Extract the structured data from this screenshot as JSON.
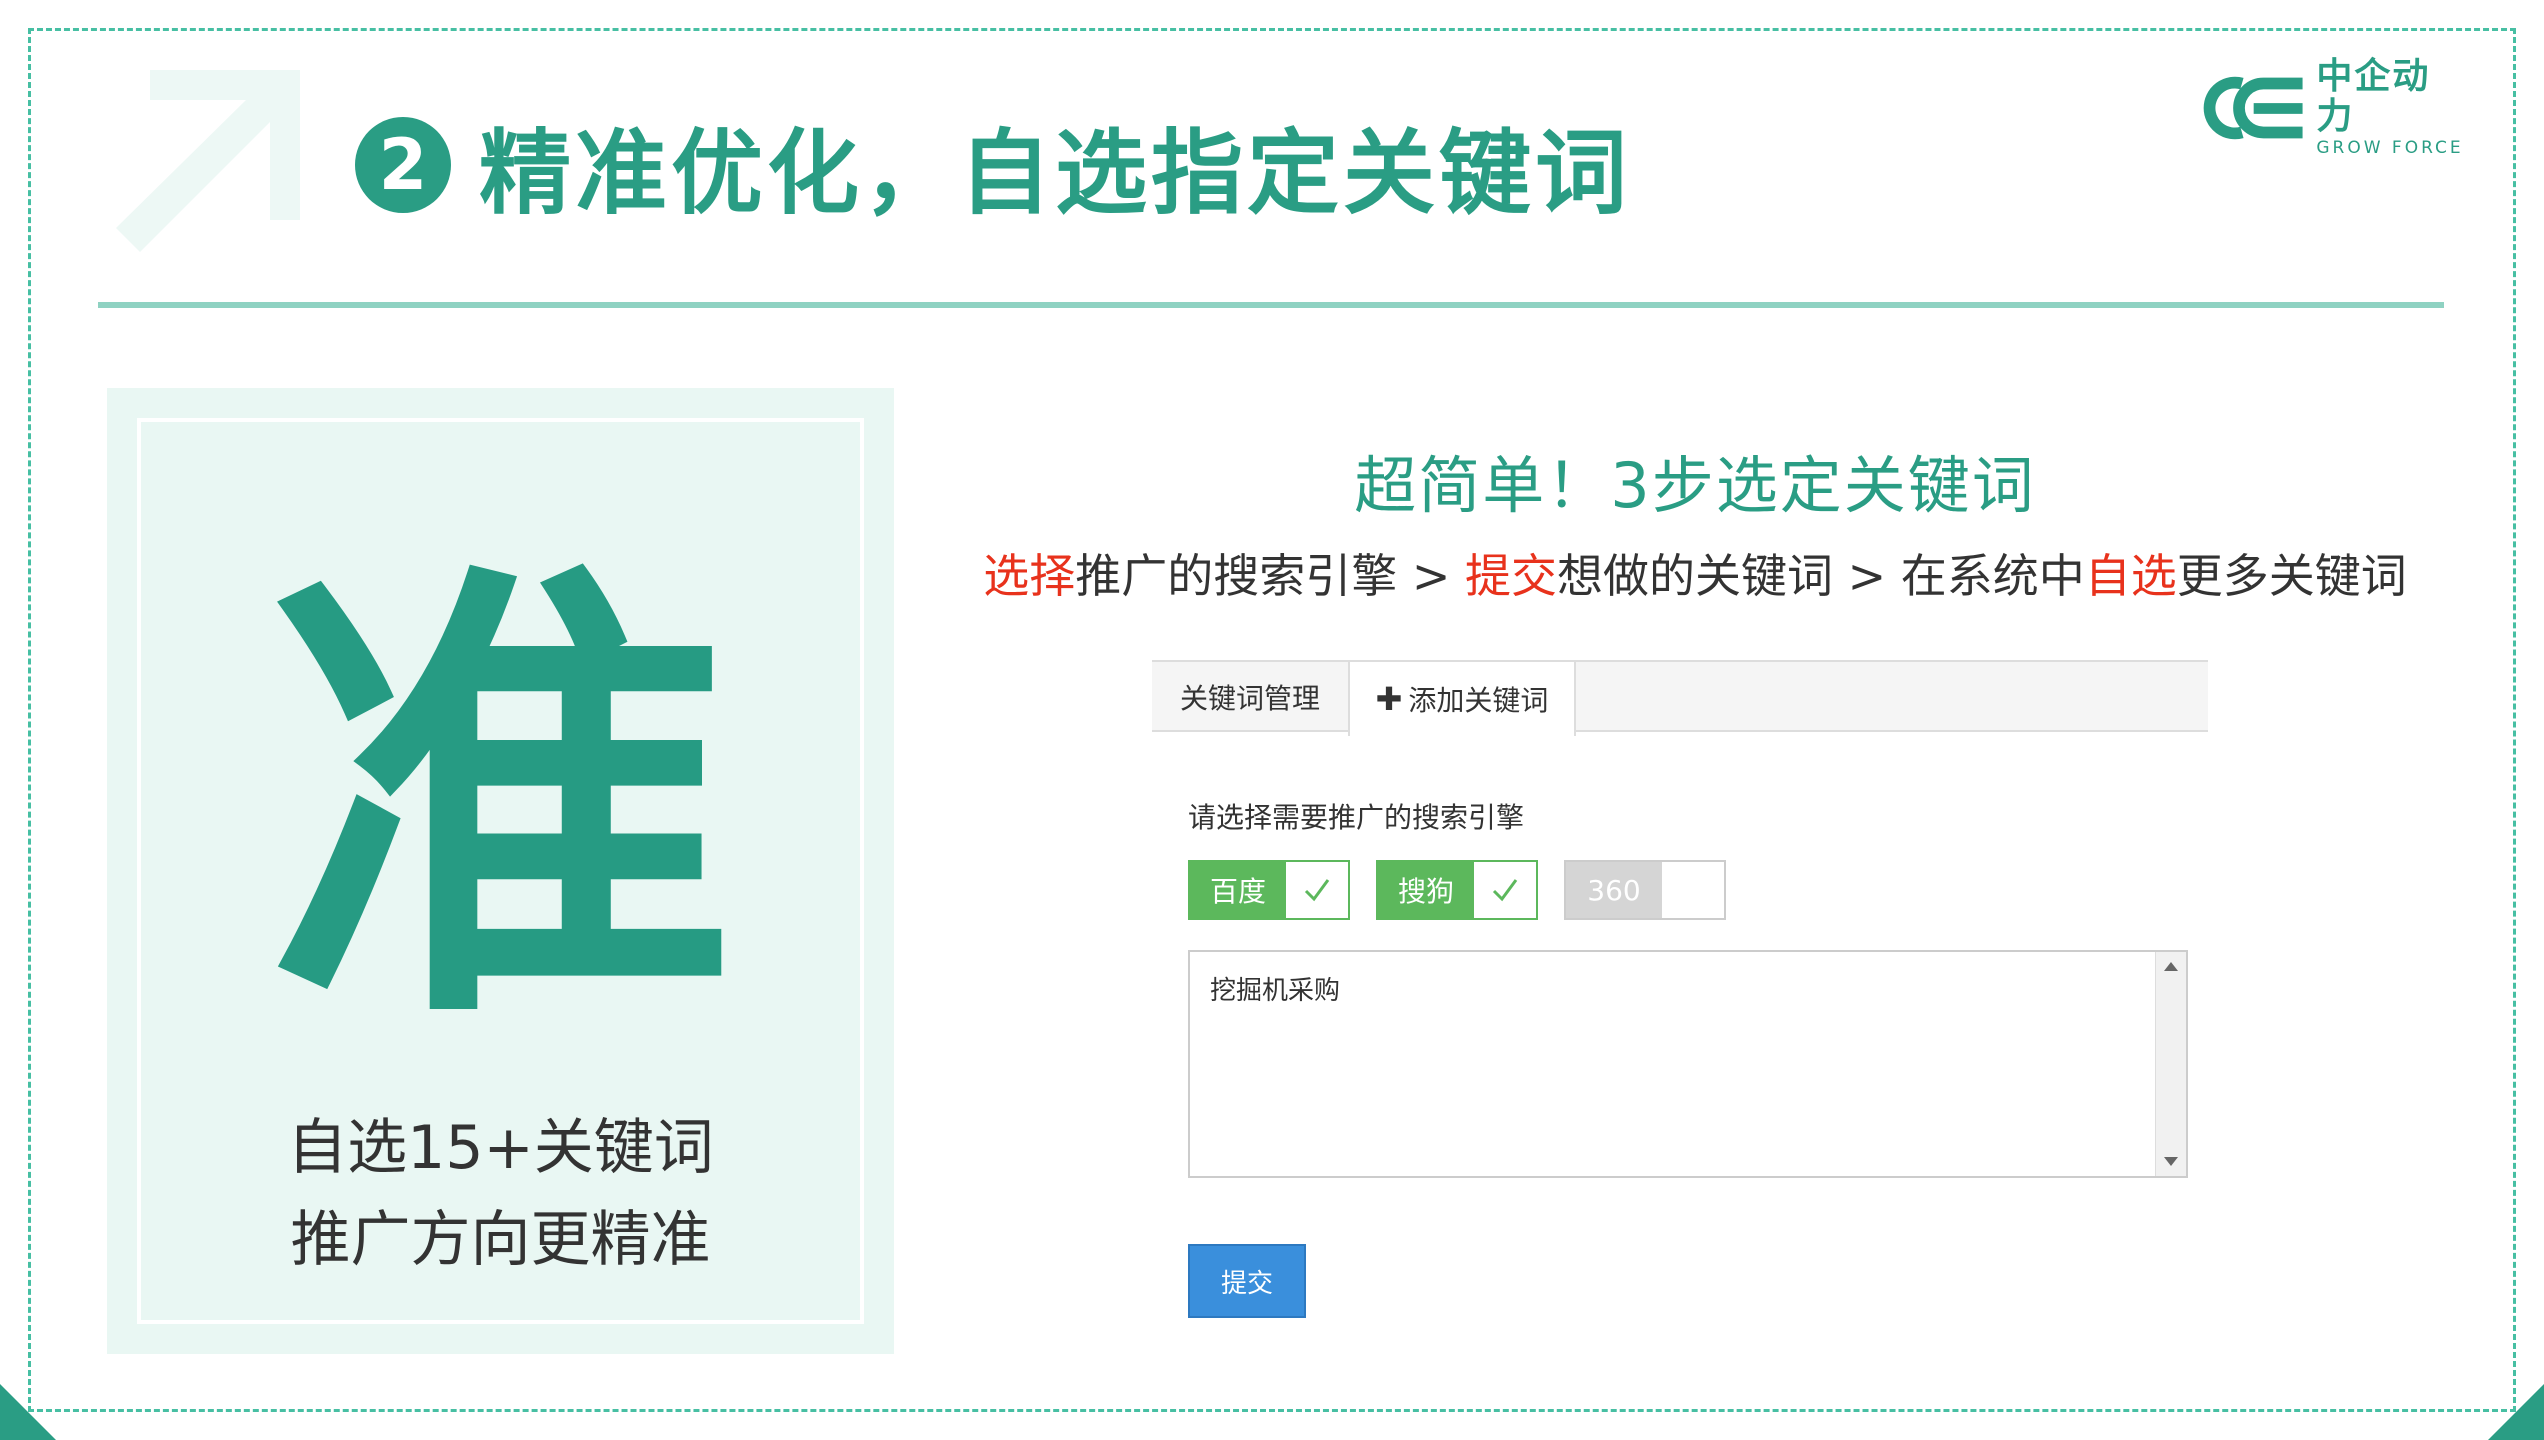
{
  "header": {
    "badge_number": "2",
    "title": "精准优化，自选指定关键词"
  },
  "logo": {
    "cn": "中企动力",
    "en": "GROW FORCE"
  },
  "left_panel": {
    "big_char": "准",
    "caption_line1": "自选15+关键词",
    "caption_line2": "推广方向更精准"
  },
  "steps": {
    "title": "超简单！3步选定关键词",
    "line": [
      {
        "text": "选择",
        "highlight": true
      },
      {
        "text": "推广的搜索引擎 > ",
        "highlight": false
      },
      {
        "text": "提交",
        "highlight": true
      },
      {
        "text": "想做的关键词 > 在系统中",
        "highlight": false
      },
      {
        "text": "自选",
        "highlight": true
      },
      {
        "text": "更多关键词",
        "highlight": false
      }
    ]
  },
  "ui": {
    "tabs": {
      "manage": "关键词管理",
      "add": "添加关键词"
    },
    "engine_label": "请选择需要推广的搜索引擎",
    "engines": [
      {
        "name": "百度",
        "checked": true
      },
      {
        "name": "搜狗",
        "checked": true
      },
      {
        "name": "360",
        "checked": false
      }
    ],
    "keyword_text": "挖掘机采购",
    "submit_label": "提交"
  },
  "colors": {
    "brand": "#2a9d84",
    "highlight": "#e8321c",
    "engine_on": "#5cb85c",
    "button": "#3a8fdc"
  }
}
